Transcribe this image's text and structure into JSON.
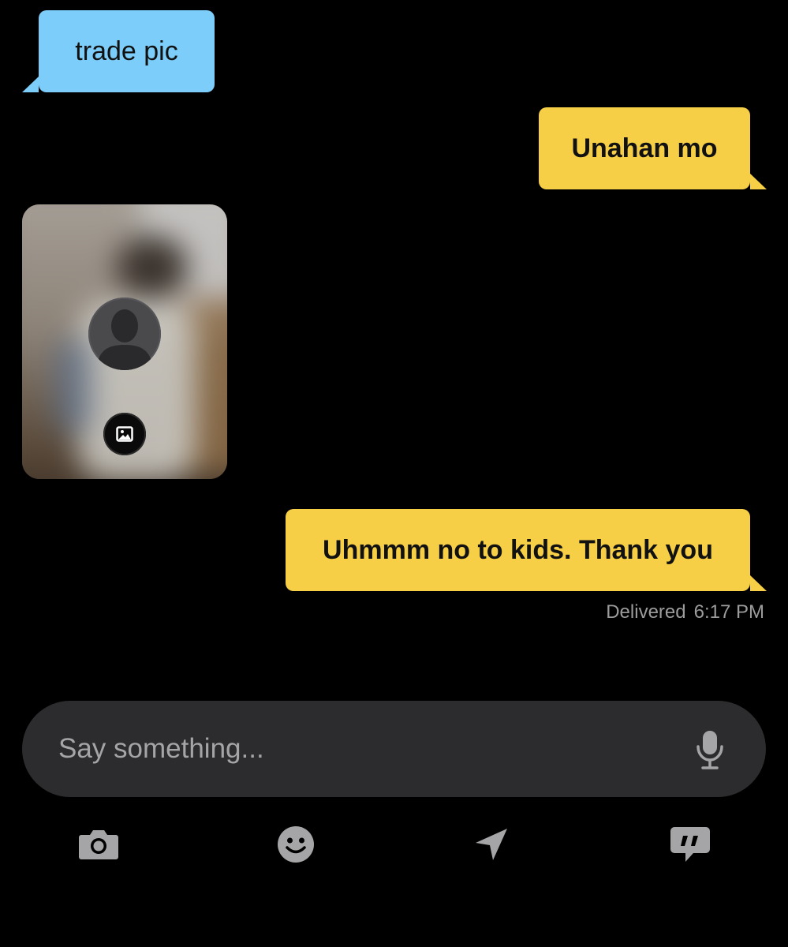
{
  "messages": [
    {
      "direction": "incoming",
      "type": "text",
      "text": "trade pic"
    },
    {
      "direction": "outgoing",
      "type": "text",
      "text": "Unahan mo"
    },
    {
      "direction": "incoming",
      "type": "image",
      "icon": "image-icon",
      "avatar_icon": "profile-silhouette-icon"
    },
    {
      "direction": "outgoing",
      "type": "text",
      "text": "Uhmmm no to kids. Thank you"
    }
  ],
  "status": {
    "label": "Delivered",
    "time": "6:17 PM"
  },
  "composer": {
    "placeholder": "Say something...",
    "mic_icon": "microphone-icon"
  },
  "toolbar": [
    {
      "icon": "camera-icon"
    },
    {
      "icon": "emoji-icon"
    },
    {
      "icon": "location-arrow-icon"
    },
    {
      "icon": "saved-phrases-icon"
    }
  ],
  "colors": {
    "background": "#000000",
    "incoming_bubble": "#7dcdfa",
    "outgoing_bubble": "#f6cf47",
    "input_background": "#2c2c2e",
    "icon": "#a5a5a7",
    "status_text": "#9c9c9c"
  }
}
